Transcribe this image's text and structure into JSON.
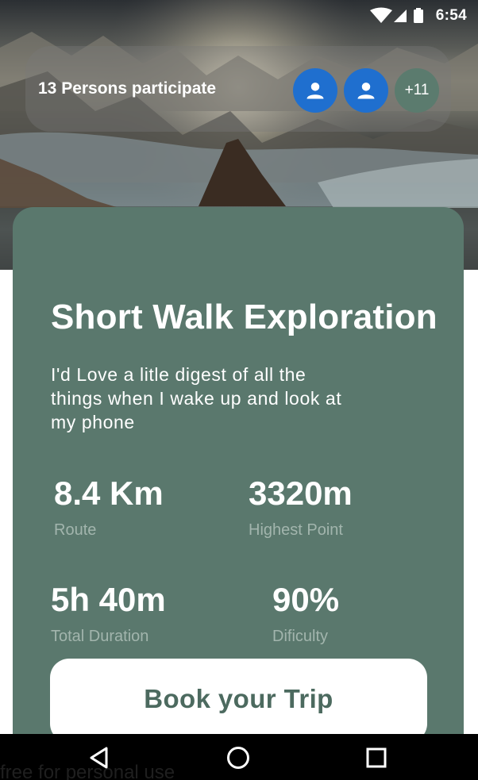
{
  "status": {
    "time": "6:54",
    "icons": [
      "wifi-icon",
      "cell-signal-icon",
      "battery-icon"
    ]
  },
  "hero": {
    "participants_text": "13 Persons participate",
    "avatars": [
      "person-icon",
      "person-icon"
    ],
    "more_count": "+11",
    "avatar_color": "#1f6fcf"
  },
  "card": {
    "title": "Short Walk Exploration",
    "description": "I'd Love a litle digest of all the things when I wake up and look at my phone",
    "stats": [
      {
        "value": "8.4 Km",
        "label": "Route"
      },
      {
        "value": "3320m",
        "label": "Highest Point"
      },
      {
        "value": "5h 40m",
        "label": "Total Duration"
      },
      {
        "value": "90%",
        "label": "Dificulty"
      }
    ],
    "button_label": "Book your Trip",
    "accent_color": "#5a786d"
  },
  "footer": {
    "text": "free for personal use"
  },
  "nav": {
    "icons": [
      "back-icon",
      "home-icon",
      "recents-icon"
    ]
  }
}
